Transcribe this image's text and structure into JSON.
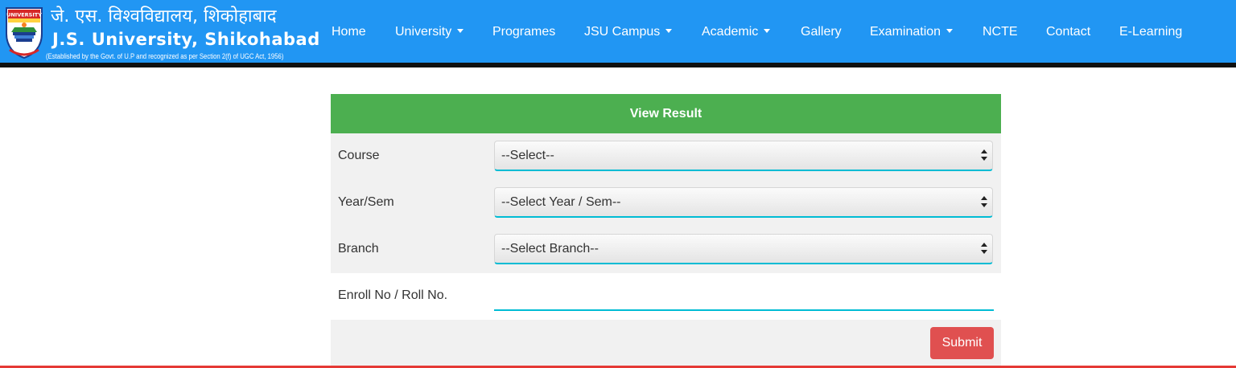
{
  "brand": {
    "hindi_name": "जे. एस. विश्वविद्यालय, शिकोहाबाद",
    "english_name": "J.S. University, Shikohabad",
    "subtitle": "(Established by the Govt. of U.P and recognized as per Section 2(f) of UGC Act, 1956)",
    "logo_text": "J.S. UNIVERSITY"
  },
  "nav": {
    "items": [
      {
        "label": "Home",
        "dropdown": false
      },
      {
        "label": "University",
        "dropdown": true
      },
      {
        "label": "Programes",
        "dropdown": false
      },
      {
        "label": "JSU Campus",
        "dropdown": true
      },
      {
        "label": "Academic",
        "dropdown": true
      },
      {
        "label": "Gallery",
        "dropdown": false
      },
      {
        "label": "Examination",
        "dropdown": true
      },
      {
        "label": "NCTE",
        "dropdown": false
      },
      {
        "label": "Contact",
        "dropdown": false
      },
      {
        "label": "E-Learning",
        "dropdown": false
      }
    ]
  },
  "form": {
    "title": "View Result",
    "course": {
      "label": "Course",
      "selected": "--Select--"
    },
    "year_sem": {
      "label": "Year/Sem",
      "selected": "--Select Year / Sem--"
    },
    "branch": {
      "label": "Branch",
      "selected": "--Select Branch--"
    },
    "enroll": {
      "label": "Enroll No / Roll No.",
      "value": "",
      "placeholder": ""
    },
    "submit_label": "Submit"
  },
  "colors": {
    "navbar": "#2196f3",
    "panel_header": "#4caf50",
    "input_accent": "#00bcd4",
    "submit": "#e05050"
  }
}
